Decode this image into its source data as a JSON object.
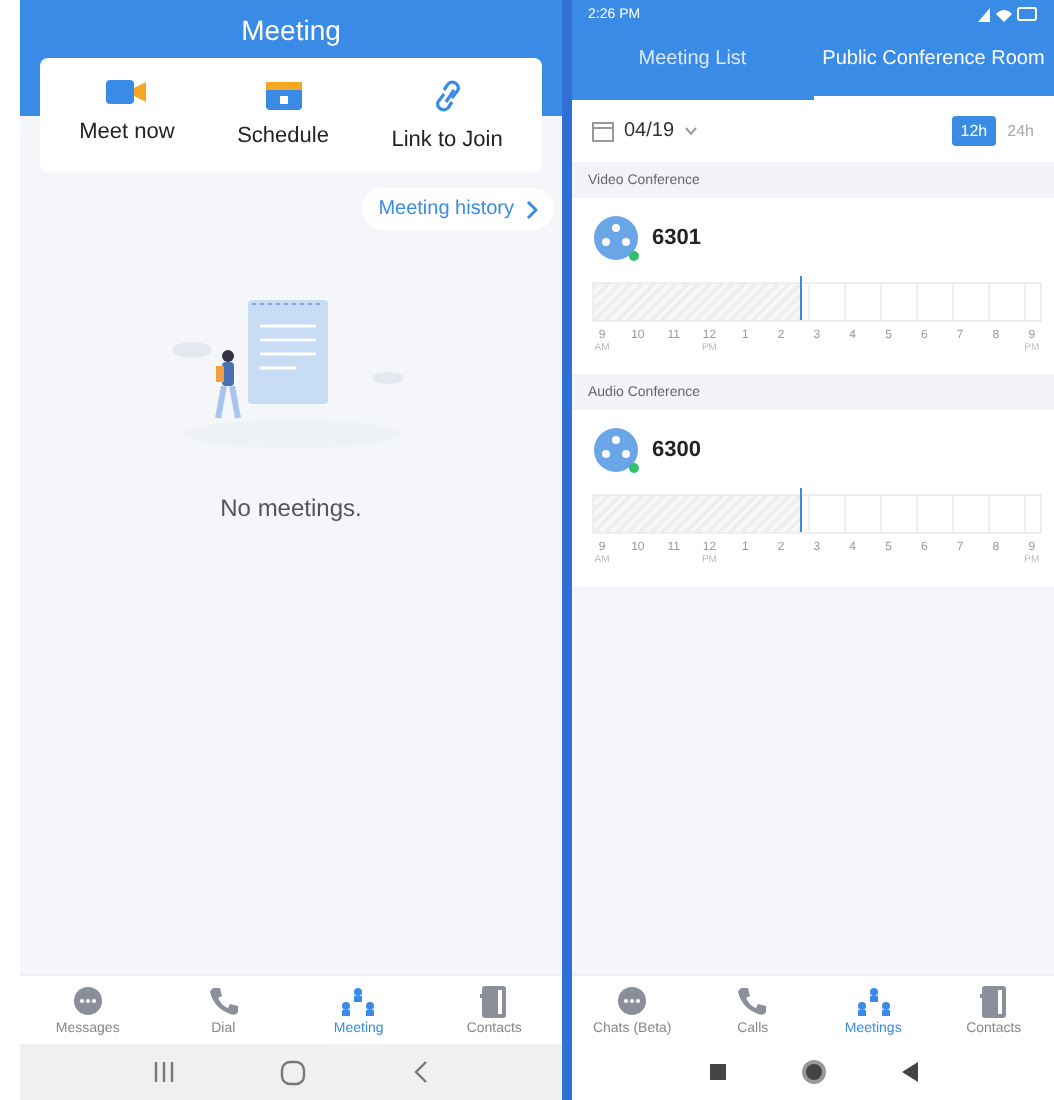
{
  "left_screen": {
    "title": "Meeting",
    "actions": [
      {
        "kind": "video",
        "label": "Meet now"
      },
      {
        "kind": "calendar",
        "label": "Schedule"
      },
      {
        "kind": "link",
        "label": "Link to Join"
      }
    ],
    "history_button": "Meeting history",
    "empty_message": "No meetings.",
    "bottom_nav": [
      {
        "kind": "chat",
        "label": "Messages",
        "selected": false
      },
      {
        "kind": "phone",
        "label": "Dial",
        "selected": false
      },
      {
        "kind": "meeting",
        "label": "Meeting",
        "selected": true
      },
      {
        "kind": "contacts",
        "label": "Contacts",
        "selected": false
      }
    ],
    "system_nav": [
      {
        "kind": "recents"
      },
      {
        "kind": "home"
      },
      {
        "kind": "back"
      }
    ]
  },
  "right_screen": {
    "status_bar": {
      "time": "2:26 PM"
    },
    "tabs": [
      {
        "label": "Meeting List",
        "selected": false
      },
      {
        "label": "Public Conference Room",
        "selected": true
      }
    ],
    "date": "04/19",
    "time_format": [
      {
        "label": "12h",
        "selected": true
      },
      {
        "label": "24h",
        "selected": false
      }
    ],
    "sections": [
      {
        "title": "Video Conference",
        "room": "6301",
        "level": 0.46,
        "hours": [
          {
            "hour": "9",
            "period": "AM"
          },
          {
            "hour": "10"
          },
          {
            "hour": "11"
          },
          {
            "hour": "12",
            "period": "PM"
          },
          {
            "hour": "1"
          },
          {
            "hour": "2"
          },
          {
            "hour": "3"
          },
          {
            "hour": "4"
          },
          {
            "hour": "5"
          },
          {
            "hour": "6"
          },
          {
            "hour": "7"
          },
          {
            "hour": "8"
          },
          {
            "hour": "9",
            "period": "PM"
          }
        ]
      },
      {
        "title": "Audio Conference",
        "room": "6300",
        "level": 0.46,
        "hours": [
          {
            "hour": "9",
            "period": "AM"
          },
          {
            "hour": "10"
          },
          {
            "hour": "11"
          },
          {
            "hour": "12",
            "period": "PM"
          },
          {
            "hour": "1"
          },
          {
            "hour": "2"
          },
          {
            "hour": "3"
          },
          {
            "hour": "4"
          },
          {
            "hour": "5"
          },
          {
            "hour": "6"
          },
          {
            "hour": "7"
          },
          {
            "hour": "8"
          },
          {
            "hour": "9",
            "period": "PM"
          }
        ]
      }
    ],
    "bottom_nav": [
      {
        "kind": "chat",
        "label": "Chats (Beta)",
        "selected": false
      },
      {
        "kind": "phone",
        "label": "Calls",
        "selected": false
      },
      {
        "kind": "meeting",
        "label": "Meetings",
        "selected": true
      },
      {
        "kind": "contacts",
        "label": "Contacts",
        "selected": false
      }
    ],
    "system_nav": [
      {
        "kind": "square"
      },
      {
        "kind": "circle"
      },
      {
        "kind": "triangle"
      }
    ]
  }
}
